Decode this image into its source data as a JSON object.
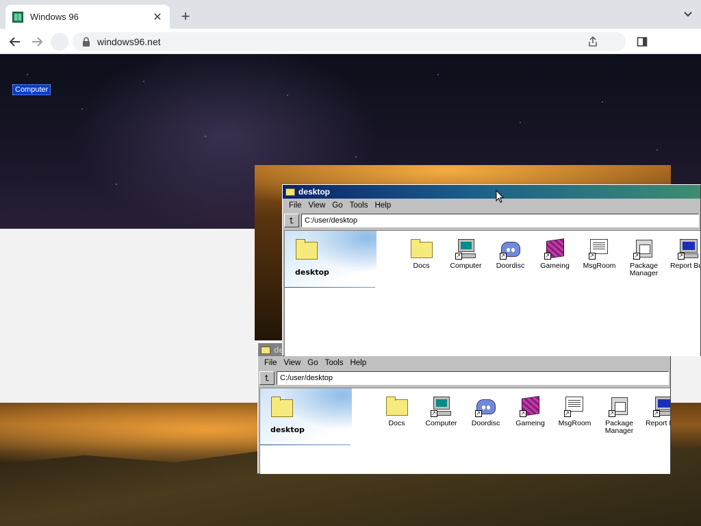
{
  "browser": {
    "tab_title": "Windows 96",
    "tab_close": "✕",
    "new_tab": "+",
    "url": "windows96.net"
  },
  "desktop": {
    "selected_icon_label": "Computer"
  },
  "explorer": {
    "title": "desktop",
    "menu": [
      "File",
      "View",
      "Go",
      "Tools",
      "Help"
    ],
    "address": "C:/user/desktop",
    "up_glyph": "⮤",
    "side_title": "desktop",
    "items": [
      {
        "label": "Docs",
        "icon": "folder-icon"
      },
      {
        "label": "Computer",
        "icon": "computer-icon"
      },
      {
        "label": "Doordisc",
        "icon": "discord-icon"
      },
      {
        "label": "Gameing",
        "icon": "cube-icon"
      },
      {
        "label": "MsgRoom",
        "icon": "message-icon"
      },
      {
        "label": "Package Manager",
        "icon": "package-icon"
      },
      {
        "label": "Report Bug",
        "icon": "bug-report-icon"
      }
    ]
  },
  "explorer_back": {
    "title": "de"
  },
  "colors": {
    "titlebar_start": "#0a246a",
    "titlebar_end": "#3c8d72",
    "win_face": "#c0c0c0"
  }
}
